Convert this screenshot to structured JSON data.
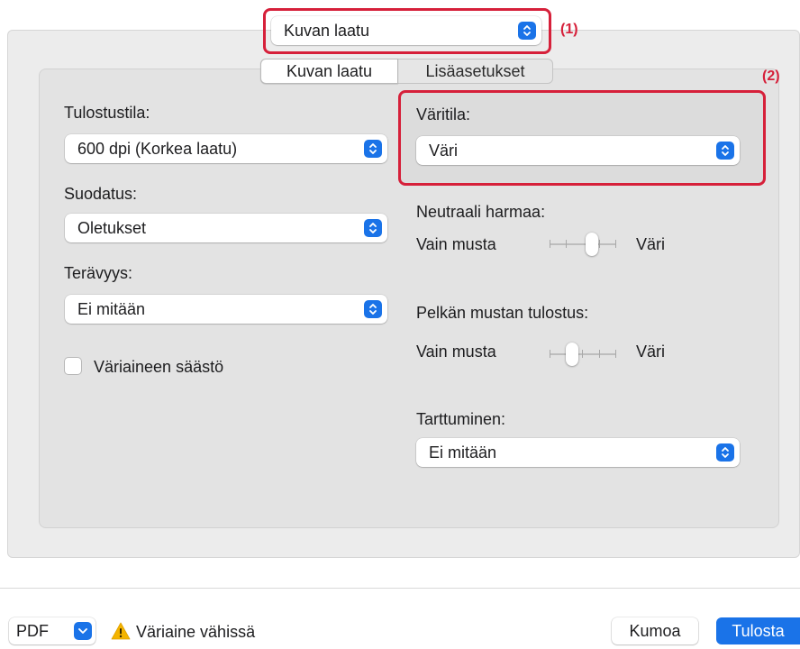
{
  "preset_popup": {
    "value": "Kuvan laatu"
  },
  "annotations": {
    "label1": "(1)",
    "label2": "(2)"
  },
  "tabs": {
    "tab1": "Kuvan laatu",
    "tab2": "Lisäasetukset"
  },
  "left": {
    "print_mode_label": "Tulostustila:",
    "print_mode_value": "600 dpi (Korkea laatu)",
    "filter_label": "Suodatus:",
    "filter_value": "Oletukset",
    "sharpness_label": "Terävyys:",
    "sharpness_value": "Ei mitään",
    "toner_save_label": "Väriaineen säästö"
  },
  "right": {
    "color_mode_label": "Väritila:",
    "color_mode_value": "Väri",
    "neutral_gray_label": "Neutraali harmaa:",
    "neutral_gray_left": "Vain musta",
    "neutral_gray_right": "Väri",
    "pure_black_label": "Pelkän mustan tulostus:",
    "pure_black_left": "Vain musta",
    "pure_black_right": "Väri",
    "trapping_label": "Tarttuminen:",
    "trapping_value": "Ei mitään"
  },
  "bottom": {
    "pdf_label": "PDF",
    "warning_text": "Väriaine vähissä",
    "cancel_label": "Kumoa",
    "print_label": "Tulosta"
  },
  "colors": {
    "accent": "#1a73e8",
    "highlight": "#d6203a",
    "warning": "#f4b400"
  },
  "icons": [
    "chevron-updown-icon",
    "chevron-down-icon",
    "warning-icon"
  ]
}
